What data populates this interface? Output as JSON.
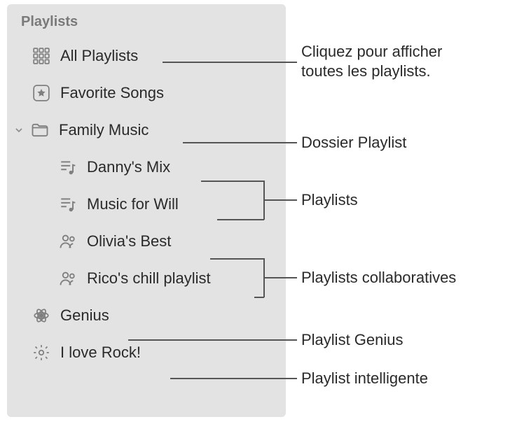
{
  "sidebar": {
    "header": "Playlists",
    "items": [
      {
        "label": "All Playlists"
      },
      {
        "label": "Favorite Songs"
      },
      {
        "label": "Family Music"
      },
      {
        "label": "Danny's Mix"
      },
      {
        "label": "Music for Will"
      },
      {
        "label": "Olivia's Best"
      },
      {
        "label": "Rico's chill playlist"
      },
      {
        "label": "Genius"
      },
      {
        "label": "I love Rock!"
      }
    ]
  },
  "callouts": {
    "all": "Cliquez pour afficher\ntoutes les playlists.",
    "folder": "Dossier Playlist",
    "playlists": "Playlists",
    "collab": "Playlists collaboratives",
    "genius": "Playlist Genius",
    "smart": "Playlist intelligente"
  }
}
